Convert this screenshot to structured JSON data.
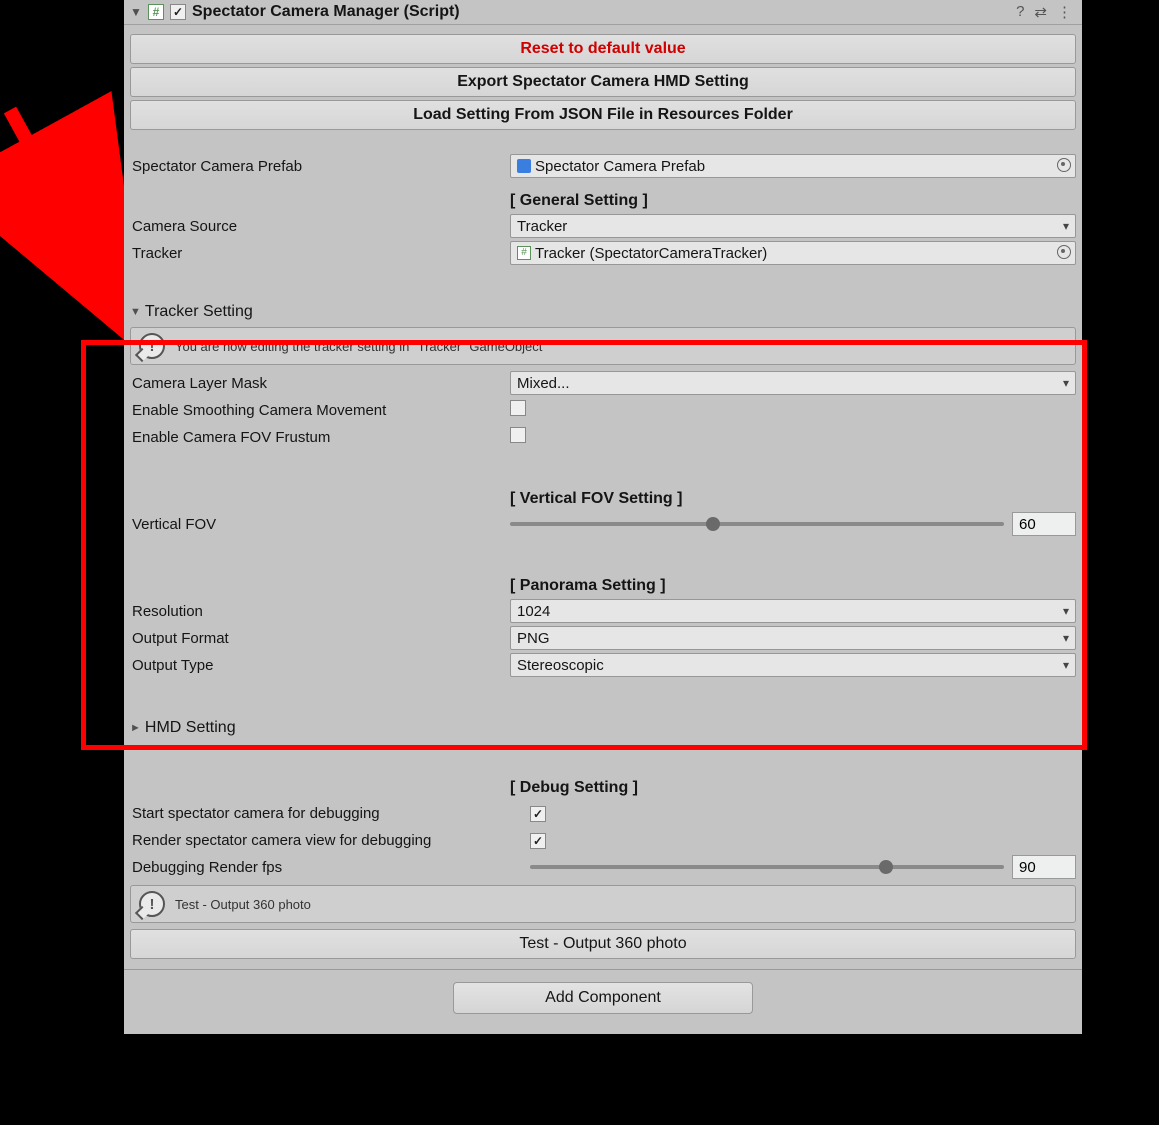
{
  "header": {
    "title": "Spectator Camera Manager (Script)"
  },
  "buttons": {
    "reset": "Reset to default value",
    "export": "Export Spectator Camera HMD Setting",
    "load": "Load Setting From JSON File in Resources Folder",
    "test360": "Test - Output 360 photo",
    "addComponent": "Add Component"
  },
  "fields": {
    "prefabLabel": "Spectator Camera Prefab",
    "prefabValue": "Spectator Camera Prefab",
    "cameraSourceLabel": "Camera Source",
    "cameraSourceValue": "Tracker",
    "trackerLabel": "Tracker",
    "trackerValue": "Tracker (SpectatorCameraTracker)"
  },
  "sections": {
    "general": "[ General Setting ]",
    "trackerSetting": "Tracker Setting",
    "verticalFov": "[ Vertical FOV Setting ]",
    "panorama": "[ Panorama Setting ]",
    "hmdSetting": "HMD Setting",
    "debug": "[ Debug Setting ]"
  },
  "tracker": {
    "info": "You are now editing the tracker setting in \"Tracker\" GameObject",
    "layerMaskLabel": "Camera Layer Mask",
    "layerMaskValue": "Mixed...",
    "smoothLabel": "Enable Smoothing Camera Movement",
    "frustumLabel": "Enable Camera FOV Frustum",
    "vFovLabel": "Vertical FOV",
    "vFovValue": "60",
    "resolutionLabel": "Resolution",
    "resolutionValue": "1024",
    "outFmtLabel": "Output Format",
    "outFmtValue": "PNG",
    "outTypeLabel": "Output Type",
    "outTypeValue": "Stereoscopic"
  },
  "debug": {
    "startLabel": "Start spectator camera for debugging",
    "renderLabel": "Render spectator camera view for debugging",
    "fpsLabel": "Debugging Render fps",
    "fpsValue": "90",
    "infoTest": "Test - Output 360 photo"
  },
  "slider": {
    "vfov_pct": 41,
    "fps_pct": 75
  }
}
